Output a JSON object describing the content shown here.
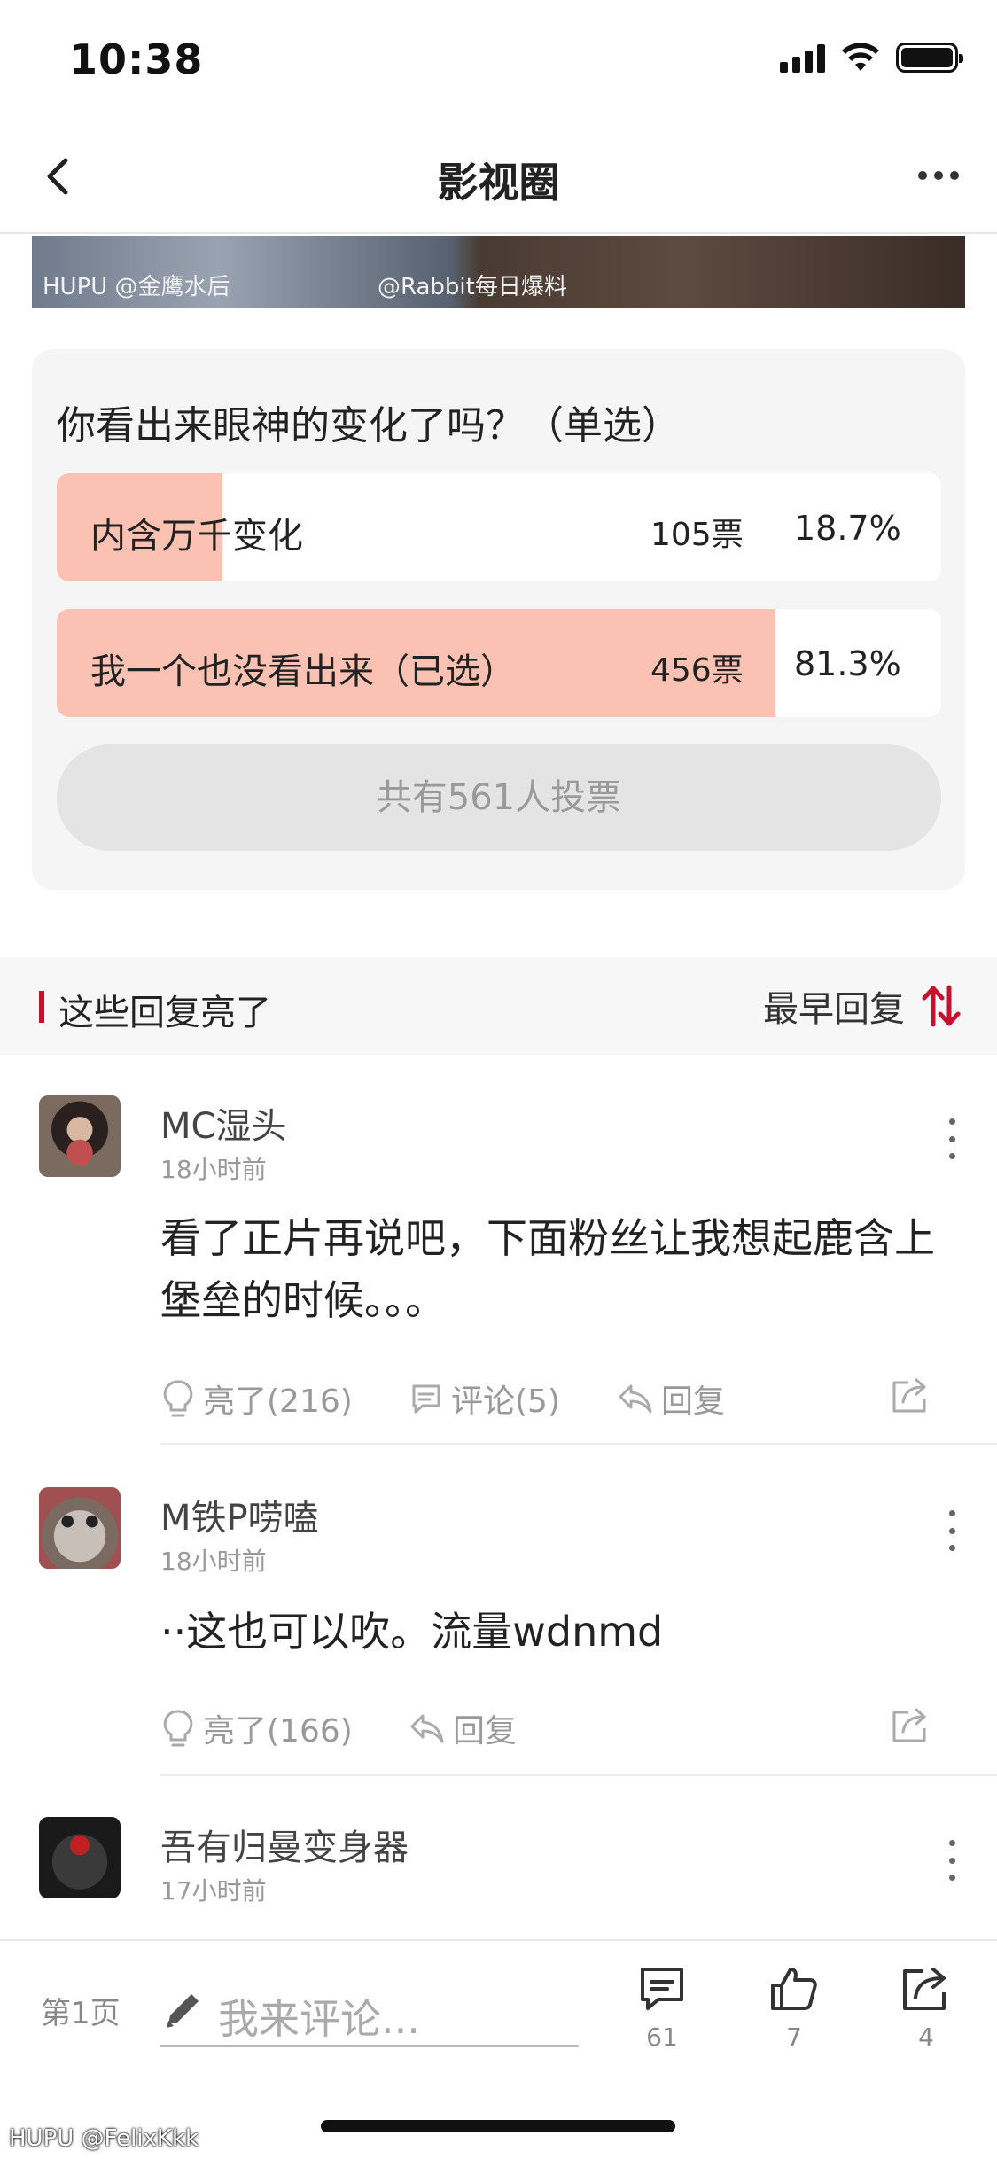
{
  "status_bar": {
    "time": "10:38"
  },
  "nav": {
    "title": "影视圈"
  },
  "image_strip": {
    "watermark_left": "HUPU @金鹰水后",
    "watermark_right": "@Rabbit每日爆料"
  },
  "poll": {
    "question": "你看出来眼神的变化了吗？（单选）",
    "options": [
      {
        "label": "内含万千变化",
        "votes": "105票",
        "percent": "18.7%",
        "fraction": 0.187
      },
      {
        "label": "我一个也没看出来（已选）",
        "votes": "456票",
        "percent": "81.3%",
        "fraction": 0.813
      }
    ],
    "total": "共有561人投票",
    "bar_color": "#fbc1b2"
  },
  "section": {
    "title": "这些回复亮了",
    "sort_label": "最早回复",
    "accent_color": "#c8102e"
  },
  "comments": [
    {
      "user": "MC湿头",
      "time": "18小时前",
      "text": "看了正片再说吧，下面粉丝让我想起鹿含上堡垒的时候。。。",
      "like": "亮了(216)",
      "comment": "评论(5)",
      "reply": "回复"
    },
    {
      "user": "M铁P唠嗑",
      "time": "18小时前",
      "text": "··这也可以吹。流量wdnmd",
      "like": "亮了(166)",
      "reply": "回复"
    },
    {
      "user": "吾有归曼变身器",
      "time": "17小时前"
    }
  ],
  "bottom_bar": {
    "page": "第1页",
    "placeholder": "我来评论...",
    "comments_count": "61",
    "likes_count": "7",
    "shares_count": "4"
  },
  "watermark": "HUPU @FelixKkk"
}
